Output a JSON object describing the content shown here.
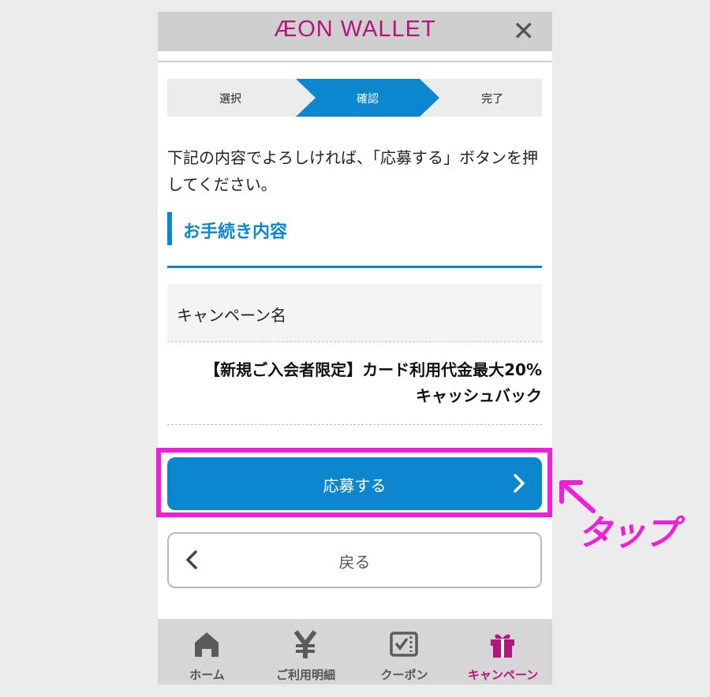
{
  "header": {
    "logo": "ÆON WALLET",
    "close": "✕"
  },
  "steps": [
    {
      "label": "選択",
      "active": false
    },
    {
      "label": "確認",
      "active": true
    },
    {
      "label": "完了",
      "active": false
    }
  ],
  "intro": "下記の内容でよろしければ、「応募する」ボタンを押してください。",
  "section": {
    "title": "お手続き内容"
  },
  "campaign": {
    "label": "キャンペーン名",
    "value_line1": "【新規ご入会者限定】カード利用代金最大20%",
    "value_line2": "キャッシュバック"
  },
  "buttons": {
    "apply": "応募する",
    "back": "戻る"
  },
  "tabbar": [
    {
      "label": "ホーム",
      "icon": "home-icon"
    },
    {
      "label": "ご利用明細",
      "icon": "yen-icon"
    },
    {
      "label": "クーポン",
      "icon": "coupon-icon"
    },
    {
      "label": "キャンペーン",
      "icon": "gift-icon",
      "active": true
    }
  ],
  "annotation": {
    "text": "タップ"
  },
  "colors": {
    "brand": "#b5147e",
    "accent": "#0b86cf",
    "annotation": "#f01ed8"
  }
}
